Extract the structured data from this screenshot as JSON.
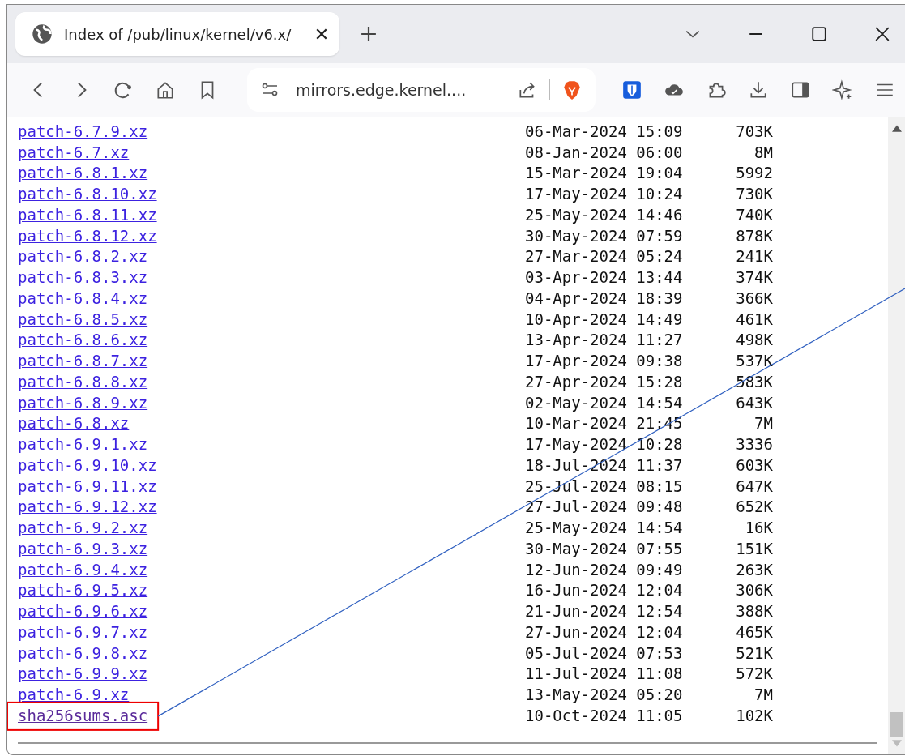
{
  "window": {
    "tab_title": "Index of /pub/linux/kernel/v6.x/",
    "address": "mirrors.edge.kernel...."
  },
  "listing": [
    {
      "name": "patch-6.7.9.xz",
      "date": "06-Mar-2024 15:09",
      "size": "703K",
      "visited": false,
      "highlighted": false
    },
    {
      "name": "patch-6.7.xz",
      "date": "08-Jan-2024 06:00",
      "size": "8M",
      "visited": false,
      "highlighted": false
    },
    {
      "name": "patch-6.8.1.xz",
      "date": "15-Mar-2024 19:04",
      "size": "5992",
      "visited": false,
      "highlighted": false
    },
    {
      "name": "patch-6.8.10.xz",
      "date": "17-May-2024 10:24",
      "size": "730K",
      "visited": false,
      "highlighted": false
    },
    {
      "name": "patch-6.8.11.xz",
      "date": "25-May-2024 14:46",
      "size": "740K",
      "visited": false,
      "highlighted": false
    },
    {
      "name": "patch-6.8.12.xz",
      "date": "30-May-2024 07:59",
      "size": "878K",
      "visited": false,
      "highlighted": false
    },
    {
      "name": "patch-6.8.2.xz",
      "date": "27-Mar-2024 05:24",
      "size": "241K",
      "visited": false,
      "highlighted": false
    },
    {
      "name": "patch-6.8.3.xz",
      "date": "03-Apr-2024 13:44",
      "size": "374K",
      "visited": false,
      "highlighted": false
    },
    {
      "name": "patch-6.8.4.xz",
      "date": "04-Apr-2024 18:39",
      "size": "366K",
      "visited": false,
      "highlighted": false
    },
    {
      "name": "patch-6.8.5.xz",
      "date": "10-Apr-2024 14:49",
      "size": "461K",
      "visited": false,
      "highlighted": false
    },
    {
      "name": "patch-6.8.6.xz",
      "date": "13-Apr-2024 11:27",
      "size": "498K",
      "visited": false,
      "highlighted": false
    },
    {
      "name": "patch-6.8.7.xz",
      "date": "17-Apr-2024 09:38",
      "size": "537K",
      "visited": false,
      "highlighted": false
    },
    {
      "name": "patch-6.8.8.xz",
      "date": "27-Apr-2024 15:28",
      "size": "583K",
      "visited": false,
      "highlighted": false
    },
    {
      "name": "patch-6.8.9.xz",
      "date": "02-May-2024 14:54",
      "size": "643K",
      "visited": false,
      "highlighted": false
    },
    {
      "name": "patch-6.8.xz",
      "date": "10-Mar-2024 21:45",
      "size": "7M",
      "visited": false,
      "highlighted": false
    },
    {
      "name": "patch-6.9.1.xz",
      "date": "17-May-2024 10:28",
      "size": "3336",
      "visited": false,
      "highlighted": false
    },
    {
      "name": "patch-6.9.10.xz",
      "date": "18-Jul-2024 11:37",
      "size": "603K",
      "visited": false,
      "highlighted": false
    },
    {
      "name": "patch-6.9.11.xz",
      "date": "25-Jul-2024 08:15",
      "size": "647K",
      "visited": false,
      "highlighted": false
    },
    {
      "name": "patch-6.9.12.xz",
      "date": "27-Jul-2024 09:48",
      "size": "652K",
      "visited": false,
      "highlighted": false
    },
    {
      "name": "patch-6.9.2.xz",
      "date": "25-May-2024 14:54",
      "size": "16K",
      "visited": false,
      "highlighted": false
    },
    {
      "name": "patch-6.9.3.xz",
      "date": "30-May-2024 07:55",
      "size": "151K",
      "visited": false,
      "highlighted": false
    },
    {
      "name": "patch-6.9.4.xz",
      "date": "12-Jun-2024 09:49",
      "size": "263K",
      "visited": false,
      "highlighted": false
    },
    {
      "name": "patch-6.9.5.xz",
      "date": "16-Jun-2024 12:04",
      "size": "306K",
      "visited": false,
      "highlighted": false
    },
    {
      "name": "patch-6.9.6.xz",
      "date": "21-Jun-2024 12:54",
      "size": "388K",
      "visited": false,
      "highlighted": false
    },
    {
      "name": "patch-6.9.7.xz",
      "date": "27-Jun-2024 12:04",
      "size": "465K",
      "visited": false,
      "highlighted": false
    },
    {
      "name": "patch-6.9.8.xz",
      "date": "05-Jul-2024 07:53",
      "size": "521K",
      "visited": false,
      "highlighted": false
    },
    {
      "name": "patch-6.9.9.xz",
      "date": "11-Jul-2024 11:08",
      "size": "572K",
      "visited": false,
      "highlighted": false
    },
    {
      "name": "patch-6.9.xz",
      "date": "13-May-2024 05:20",
      "size": "7M",
      "visited": false,
      "highlighted": false
    },
    {
      "name": "sha256sums.asc",
      "date": "10-Oct-2024 11:05",
      "size": "102K",
      "visited": true,
      "highlighted": true
    }
  ]
}
